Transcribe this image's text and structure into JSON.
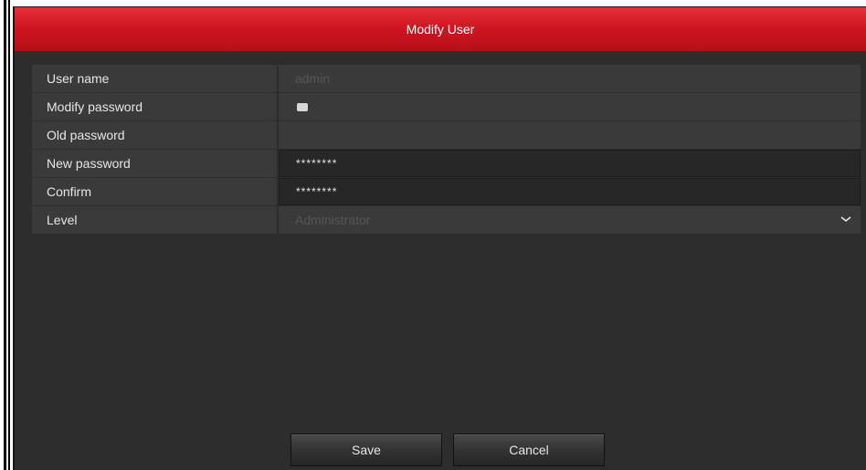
{
  "dialog": {
    "title": "Modify User"
  },
  "form": {
    "user_name": {
      "label": "User name",
      "value": "admin"
    },
    "modify_password": {
      "label": "Modify password",
      "checked": false
    },
    "old_password": {
      "label": "Old password",
      "value": ""
    },
    "new_password": {
      "label": "New password",
      "value": "********"
    },
    "confirm": {
      "label": "Confirm",
      "value": "********"
    },
    "level": {
      "label": "Level",
      "value": "Administrator",
      "icon": "chevron-down-icon"
    }
  },
  "buttons": {
    "save": "Save",
    "cancel": "Cancel"
  },
  "colors": {
    "title_bar": "#cf1622",
    "background": "#2d2d2d",
    "row_bg": "#3a3a3a"
  }
}
